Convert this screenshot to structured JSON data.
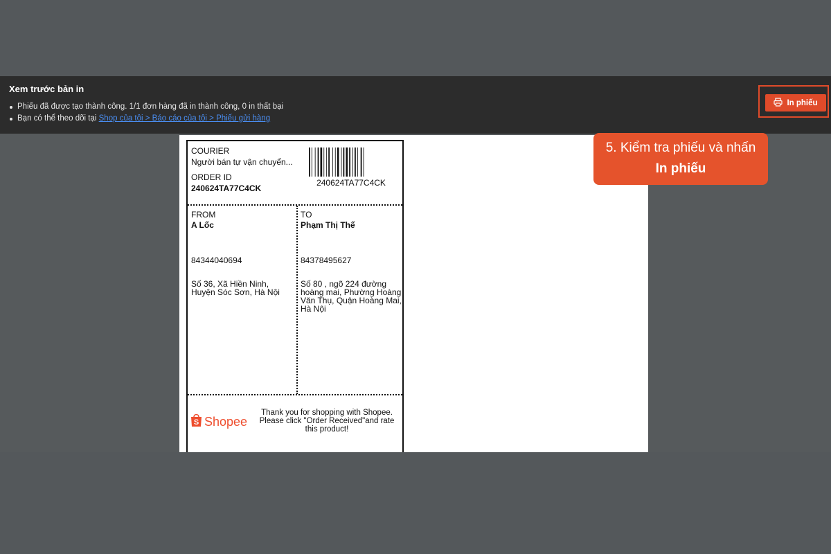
{
  "header": {
    "title": "Xem trước bản in",
    "line1": "Phiếu đã được tạo thành công. 1/1 đơn hàng đã in thành công, 0 in thất bại",
    "line2_prefix": "Bạn có thể theo dõi tại ",
    "line2_link": "Shop của tôi > Báo cáo của tôi > Phiếu gửi hàng",
    "print_button_label": "In phiếu",
    "print_icon": "printer-icon"
  },
  "label": {
    "courier_heading": "COURIER",
    "courier_value": "Người bán tự vận chuyển...",
    "order_id_heading": "ORDER ID",
    "order_id_value": "240624TA77C4CK",
    "barcode_text": "240624TA77C4CK",
    "from_heading": "FROM",
    "from_name": "A Lốc",
    "from_phone": "84344040694",
    "from_address": [
      "Số 36, Xã Hiền Ninh,",
      "Huyện Sóc Sơn, Hà Nội"
    ],
    "to_heading": "TO",
    "to_name": "Phạm Thị Thế",
    "to_phone": "84378495627",
    "to_address": [
      "Số 80 , ngõ 224 đường",
      "hoàng mai, Phường Hoàng",
      "Văn Thụ, Quận Hoàng Mai,",
      "Hà Nội"
    ],
    "shopee_logo_text": "Shopee",
    "thanks": [
      "Thank you for shopping with Shopee.",
      "Please click \"Order Received\"and rate",
      "this product!"
    ]
  },
  "callout": {
    "line1": "5. Kiểm tra phiếu và nhấn",
    "line2": "In phiếu"
  },
  "colors": {
    "accent": "#e04b2a",
    "link": "#4a8ef2",
    "header_bg": "#2c2c2c",
    "page_bg": "#54585b"
  }
}
